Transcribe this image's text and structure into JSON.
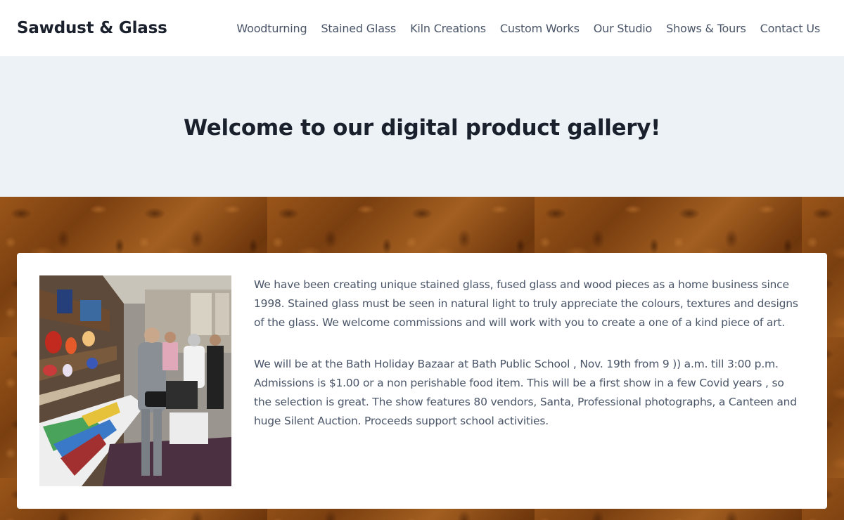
{
  "header": {
    "site_title": "Sawdust & Glass",
    "nav": [
      {
        "label": "Woodturning"
      },
      {
        "label": "Stained Glass"
      },
      {
        "label": "Kiln Creations"
      },
      {
        "label": "Custom Works"
      },
      {
        "label": "Our Studio"
      },
      {
        "label": "Shows & Tours"
      },
      {
        "label": "Contact Us"
      }
    ]
  },
  "hero": {
    "heading": "Welcome to our digital product gallery!"
  },
  "content": {
    "paragraphs": [
      "We have been creating unique stained glass, fused glass and wood pieces as a home business since 1998. Stained glass must be seen in natural light to truly appreciate the colours, textures and designs of the glass. We welcome commissions and will work with you to create a one of a kind piece of art.",
      "We will be at the Bath Holiday Bazaar at Bath Public School , Nov. 19th from 9 )) a.m. till 3:00 p.m. Admissions is $1.00 or a non perishable food item.  This will be a first show in a  few Covid years , so the selection is great.  The show features 80 vendors,  Santa,  Professional photographs, a Canteen and huge Silent Auction.  Proceeds support school activities."
    ]
  },
  "colors": {
    "header_bg": "#ffffff",
    "hero_bg": "#edf2f7",
    "title_text": "#1a202c",
    "nav_text": "#4a5568",
    "body_text": "#4a5568",
    "burl_wood": "#8a4a14",
    "card_bg": "#ffffff"
  }
}
